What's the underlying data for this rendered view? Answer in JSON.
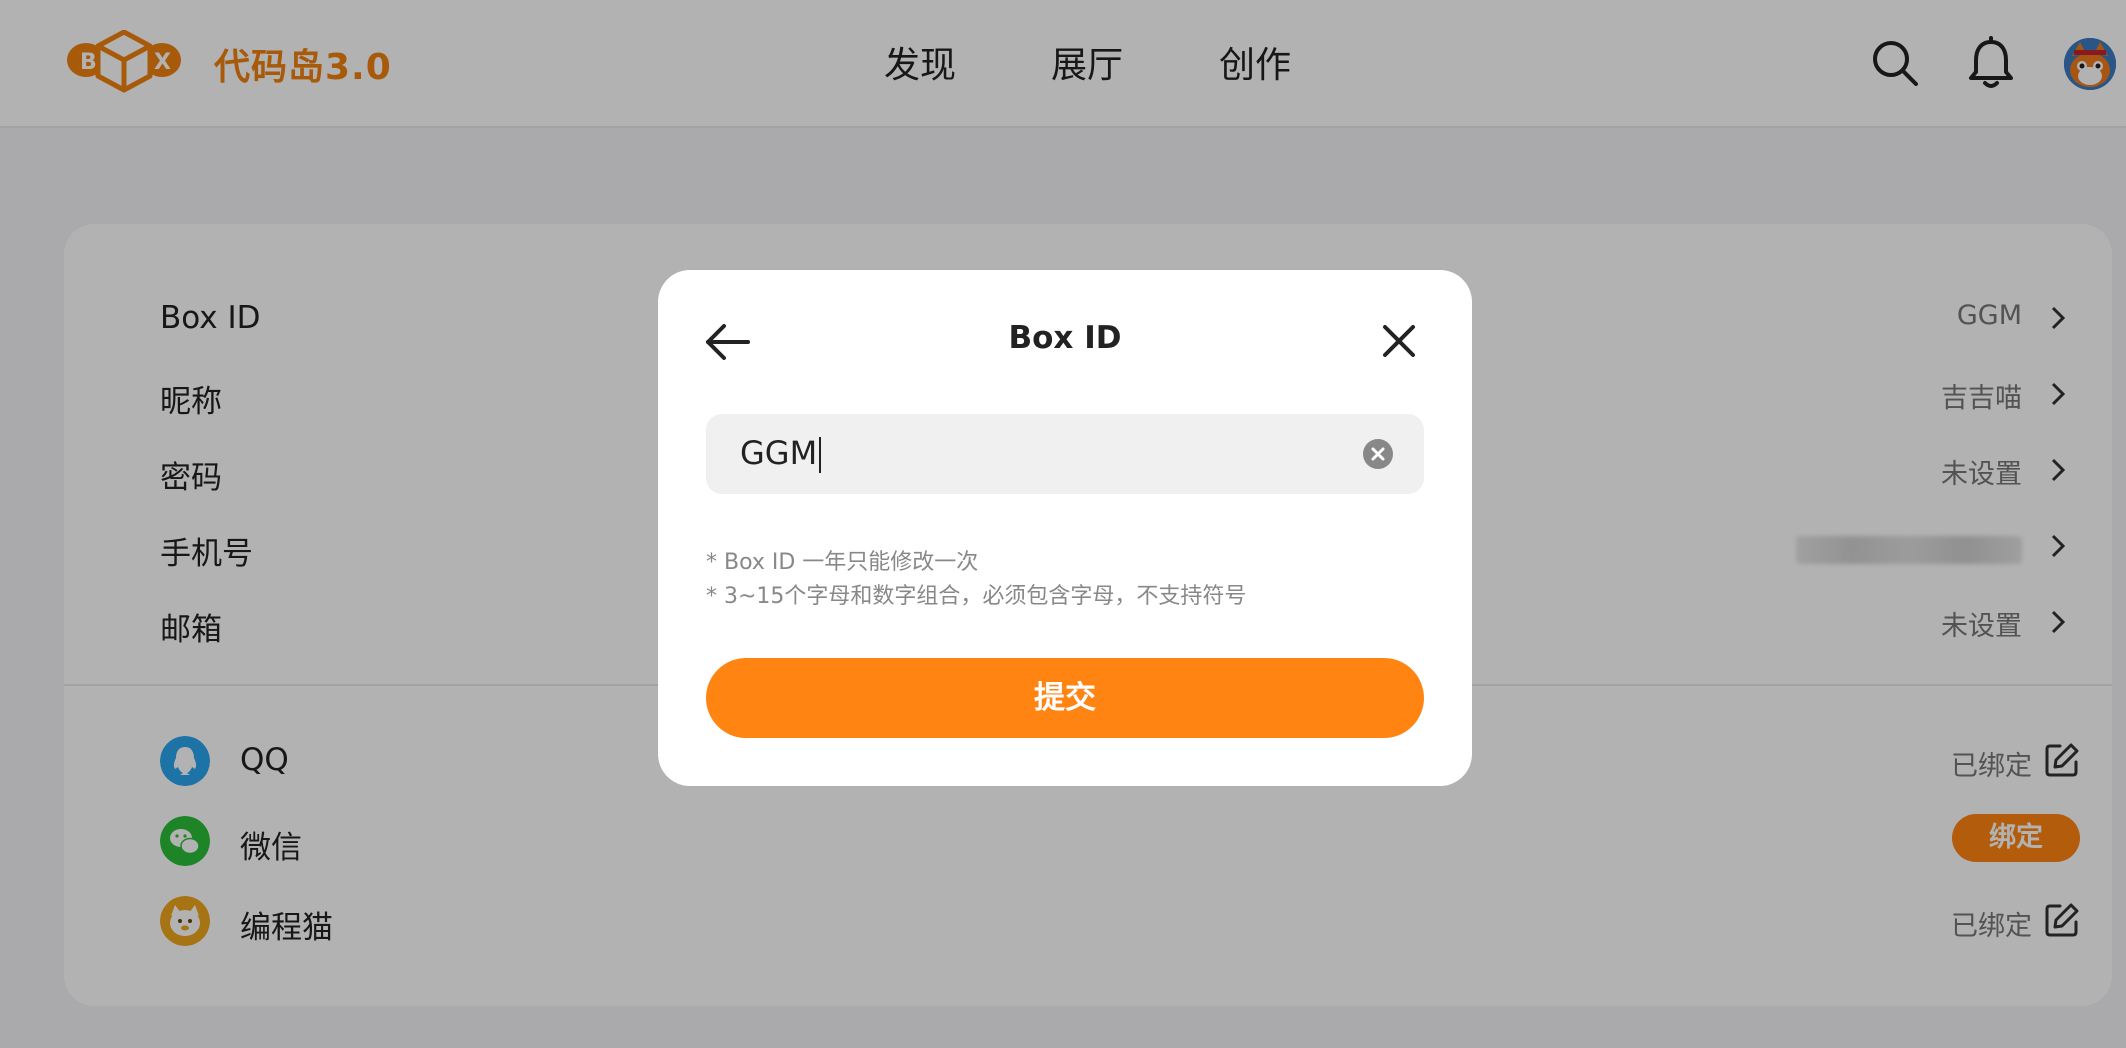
{
  "header": {
    "brand": "代码岛3.0",
    "nav": [
      "发现",
      "展厅",
      "创作"
    ],
    "icons": [
      "search-icon",
      "bell-icon",
      "avatar"
    ]
  },
  "settings": {
    "rows": [
      {
        "label": "Box ID",
        "value": "GGM"
      },
      {
        "label": "昵称",
        "value": "吉吉喵"
      },
      {
        "label": "密码",
        "value": "未设置"
      },
      {
        "label": "手机号",
        "value": ""
      },
      {
        "label": "邮箱",
        "value": "未设置"
      }
    ],
    "bindings": [
      {
        "label": "QQ",
        "status": "已绑定",
        "icon": "qq-icon",
        "color": "#2aa4ee"
      },
      {
        "label": "微信",
        "button": "绑定",
        "icon": "wechat-icon",
        "color": "#2bbd3a"
      },
      {
        "label": "编程猫",
        "status": "已绑定",
        "icon": "codemao-icon",
        "color": "#f0a71c"
      }
    ]
  },
  "modal": {
    "title": "Box ID",
    "input_value": "GGM",
    "hints": [
      "* Box ID 一年只能修改一次",
      "* 3~15个字母和数字组合，必须包含字母，不支持符号"
    ],
    "submit_label": "提交"
  },
  "colors": {
    "accent": "#ff8412",
    "brand": "#f0820f",
    "overlay": "rgba(0,0,0,0.30)"
  }
}
